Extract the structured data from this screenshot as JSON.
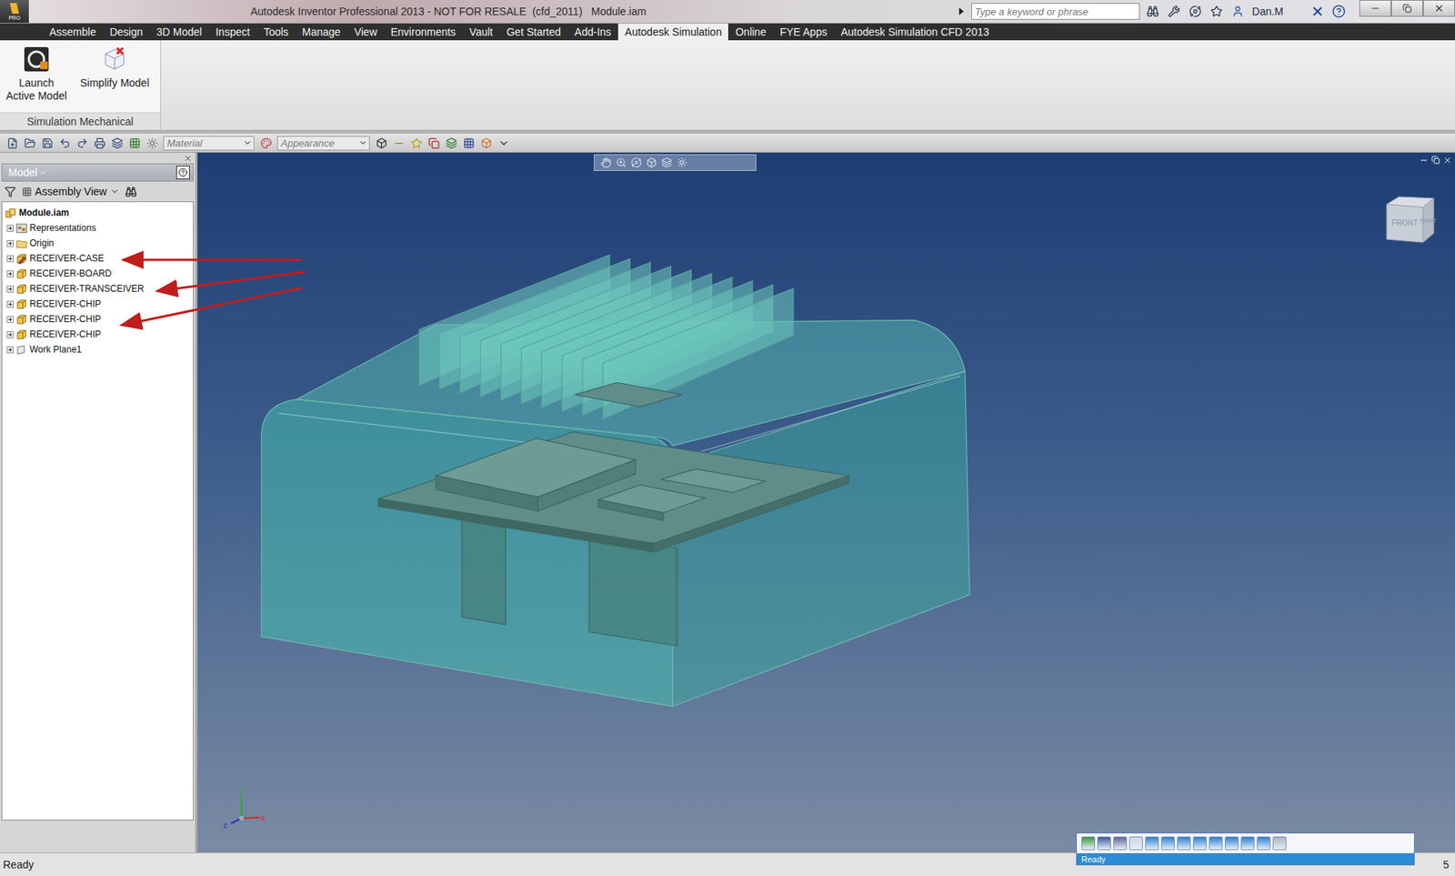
{
  "window": {
    "title": "Autodesk Inventor Professional 2013 - NOT FOR RESALE  (cfd_2011)   Module.iam",
    "app_badge": "PRO"
  },
  "search": {
    "placeholder": "Type a keyword or phrase"
  },
  "user": {
    "name": "Dan.M"
  },
  "ribbon_tabs": [
    {
      "label": "Assemble",
      "selected": false
    },
    {
      "label": "Design",
      "selected": false
    },
    {
      "label": "3D Model",
      "selected": false
    },
    {
      "label": "Inspect",
      "selected": false
    },
    {
      "label": "Tools",
      "selected": false
    },
    {
      "label": "Manage",
      "selected": false
    },
    {
      "label": "View",
      "selected": false
    },
    {
      "label": "Environments",
      "selected": false
    },
    {
      "label": "Vault",
      "selected": false
    },
    {
      "label": "Get Started",
      "selected": false
    },
    {
      "label": "Add-Ins",
      "selected": false
    },
    {
      "label": "Autodesk Simulation",
      "selected": true
    },
    {
      "label": "Online",
      "selected": false
    },
    {
      "label": "FYE Apps",
      "selected": false
    },
    {
      "label": "Autodesk Simulation CFD 2013",
      "selected": false
    }
  ],
  "ribbon": {
    "buttons": [
      {
        "label": "Launch Active Model",
        "kind": "launch"
      },
      {
        "label": "Simplify Model",
        "kind": "simplify"
      }
    ],
    "panel": "Simulation Mechanical"
  },
  "quick_toolbar": {
    "material": "Material",
    "appearance": "Appearance"
  },
  "browser": {
    "title": "Model",
    "view": "Assembly View",
    "root": "Module.iam",
    "items": [
      {
        "label": "Representations",
        "kind": "representations",
        "expanded": false,
        "annotated": false
      },
      {
        "label": "Origin",
        "kind": "folder",
        "expanded": false,
        "annotated": false
      },
      {
        "label": "RECEIVER-CASE",
        "kind": "part-edit",
        "expanded": false,
        "annotated": true
      },
      {
        "label": "RECEIVER-BOARD",
        "kind": "part",
        "expanded": false,
        "annotated": false
      },
      {
        "label": "RECEIVER-TRANSCEIVER",
        "kind": "part",
        "expanded": false,
        "annotated": true
      },
      {
        "label": "RECEIVER-CHIP",
        "kind": "part",
        "expanded": false,
        "annotated": false
      },
      {
        "label": "RECEIVER-CHIP",
        "kind": "part",
        "expanded": false,
        "annotated": true
      },
      {
        "label": "RECEIVER-CHIP",
        "kind": "part",
        "expanded": false,
        "annotated": false
      },
      {
        "label": "Work Plane1",
        "kind": "workplane",
        "expanded": false,
        "annotated": false
      }
    ]
  },
  "viewport": {
    "view_cube": [
      "FRONT",
      "RIGHT"
    ],
    "axes": {
      "y": "y",
      "z": "z",
      "x": "x"
    }
  },
  "floating_toolbar": {
    "status": "Ready"
  },
  "status_bar": {
    "left": "Ready",
    "right": "5"
  }
}
